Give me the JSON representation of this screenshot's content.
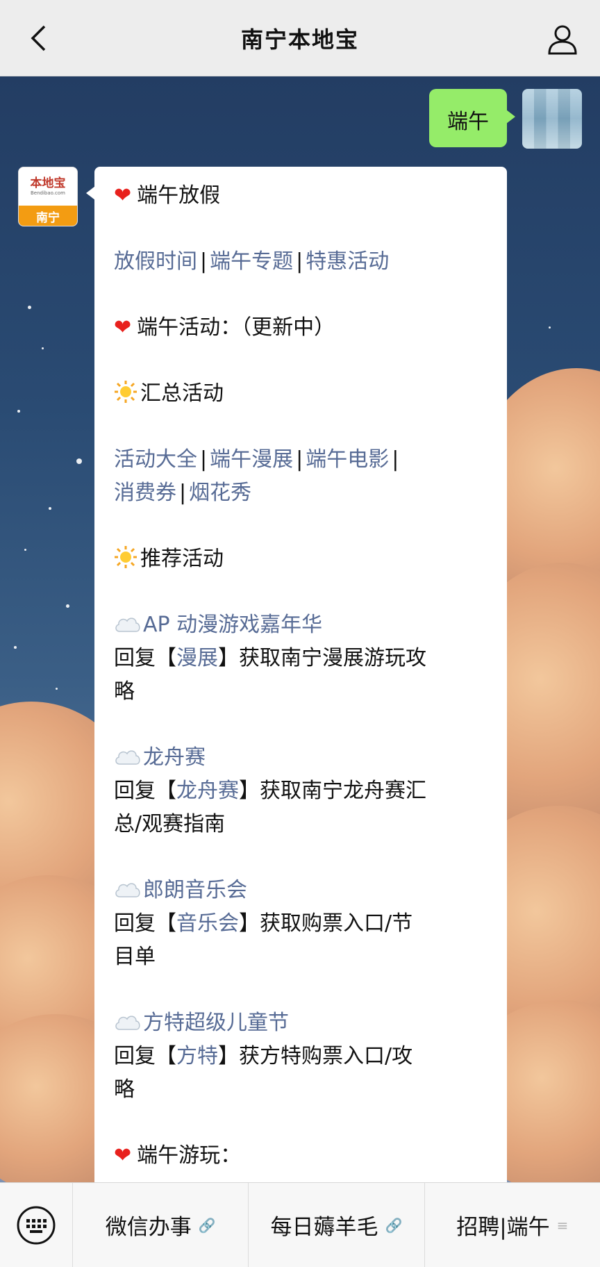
{
  "header": {
    "title": "南宁本地宝"
  },
  "outgoing": {
    "text": "端午"
  },
  "bot": {
    "avatar_brand": "本地宝",
    "avatar_domain": "Bendibao.com",
    "avatar_city": "南宁"
  },
  "message": {
    "l1_text": "端午放假",
    "l2_links": [
      "放假时间",
      "端午专题",
      "特惠活动"
    ],
    "l3_text": "端午活动：（更新中）",
    "l4_text": "汇总活动",
    "l5_links": [
      "活动大全",
      "端午漫展",
      "端午电影"
    ],
    "l6_links": [
      "消费券",
      "烟花秀"
    ],
    "l7_text": "推荐活动",
    "items": [
      {
        "title": "AP 动漫游戏嘉年华",
        "reply_pre": "回复【",
        "keyword": "漫展",
        "reply_post": "】获取南宁漫展游玩攻",
        "reply_cont": "略"
      },
      {
        "title": "龙舟赛",
        "reply_pre": "回复【",
        "keyword": "龙舟赛",
        "reply_post": "】获取南宁龙舟赛汇",
        "reply_cont": "总/观赛指南"
      },
      {
        "title": "郎朗音乐会",
        "reply_pre": "回复【",
        "keyword": "音乐会",
        "reply_post": "】获取购票入口/节",
        "reply_cont": "目单"
      },
      {
        "title": "方特超级儿童节",
        "reply_pre": "回复【",
        "keyword": "方特",
        "reply_post": "】获方特购票入口/攻",
        "reply_cont": "略"
      }
    ],
    "last_text": "端午游玩："
  },
  "bottom_menu": {
    "items": [
      "微信办事",
      "每日薅羊毛",
      "招聘|端午"
    ]
  },
  "icons": {
    "back": "chevron-left-icon",
    "profile": "person-icon",
    "heart": "heart-icon",
    "sun": "sun-icon",
    "cloud": "cloud-icon",
    "keyboard": "keyboard-icon",
    "link": "link-icon",
    "menu": "menu-lines-icon"
  },
  "colors": {
    "link": "#576b95",
    "out_bubble": "#95ec69",
    "heart": "#e8211d"
  }
}
